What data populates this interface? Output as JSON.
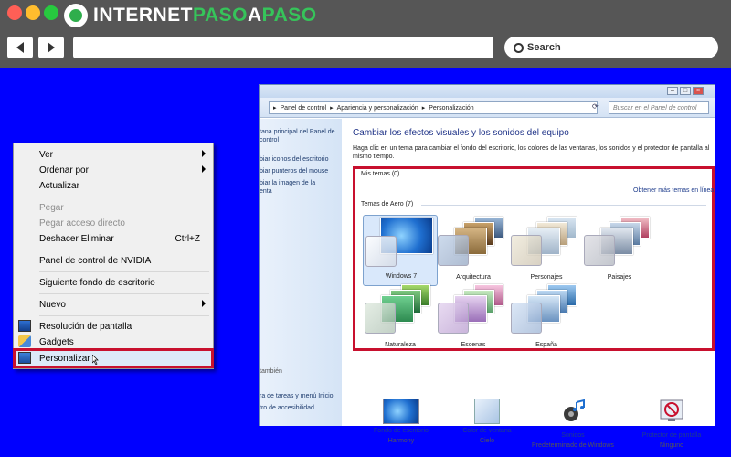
{
  "browser": {
    "logo_part1": "INTERNET",
    "logo_part2": "PASO",
    "logo_part3": "A",
    "logo_part4": "PASO",
    "back_icon": "back-arrow-icon",
    "forward_icon": "forward-arrow-icon",
    "search_label": "Search",
    "colors": {
      "close": "#ff5f56",
      "minimize": "#ffbd2e",
      "maximize": "#27c93f",
      "chrome": "#565656",
      "background": "#0000ff",
      "brand_green": "#36c45a"
    }
  },
  "context_menu": {
    "items": [
      {
        "label": "Ver",
        "submenu": true
      },
      {
        "label": "Ordenar por",
        "submenu": true
      },
      {
        "label": "Actualizar"
      },
      {
        "label": "Pegar",
        "disabled": true
      },
      {
        "label": "Pegar acceso directo",
        "disabled": true
      },
      {
        "label": "Deshacer Eliminar",
        "shortcut": "Ctrl+Z"
      },
      {
        "label": "Panel de control de NVIDIA"
      },
      {
        "label": "Siguiente fondo de escritorio"
      },
      {
        "label": "Nuevo",
        "submenu": true
      },
      {
        "label": "Resolución de pantalla",
        "icon": "monitor-icon"
      },
      {
        "label": "Gadgets",
        "icon": "gadgets-icon"
      },
      {
        "label": "Personalizar",
        "icon": "personalize-icon",
        "highlighted": true
      }
    ],
    "highlight_color": "#c8102e"
  },
  "control_panel": {
    "address": {
      "crumb1": "Panel de control",
      "crumb2": "Apariencia y personalización",
      "crumb3": "Personalización"
    },
    "search_placeholder": "Buscar en el Panel de control",
    "sidebar": {
      "link1": "tana principal del Panel de\ncontrol",
      "link2": "biar iconos del escritorio",
      "link3": "biar punteros del mouse",
      "link4": "biar la imagen de la\nenta",
      "see_also": "también",
      "link5": "ra de tareas y menú Inicio",
      "link6": "tro de accesibilidad"
    },
    "heading": "Cambiar los efectos visuales y los sonidos del equipo",
    "description": "Haga clic en un tema para cambiar el fondo del escritorio, los colores de las ventanas, los sonidos y el protector de pantalla al mismo tiempo.",
    "my_themes": "Mis temas (0)",
    "more_themes": "Obtener más temas en línea",
    "aero_themes": "Temas de Aero (7)",
    "themes": [
      {
        "name": "Windows 7",
        "selected": true
      },
      {
        "name": "Arquitectura"
      },
      {
        "name": "Personajes"
      },
      {
        "name": "Paisajes"
      },
      {
        "name": "Naturaleza"
      },
      {
        "name": "Escenas"
      },
      {
        "name": "España"
      }
    ],
    "bottom": [
      {
        "label": "Fondo de escritorio",
        "value": "Harmony",
        "icon": "desktop-background-icon"
      },
      {
        "label": "Color de ventana",
        "value": "Cielo",
        "icon": "window-color-icon"
      },
      {
        "label": "Sonidos",
        "value": "Predeterminado de Windows",
        "icon": "sounds-icon"
      },
      {
        "label": "Protector de pantalla",
        "value": "Ninguno",
        "icon": "screensaver-icon"
      }
    ]
  }
}
